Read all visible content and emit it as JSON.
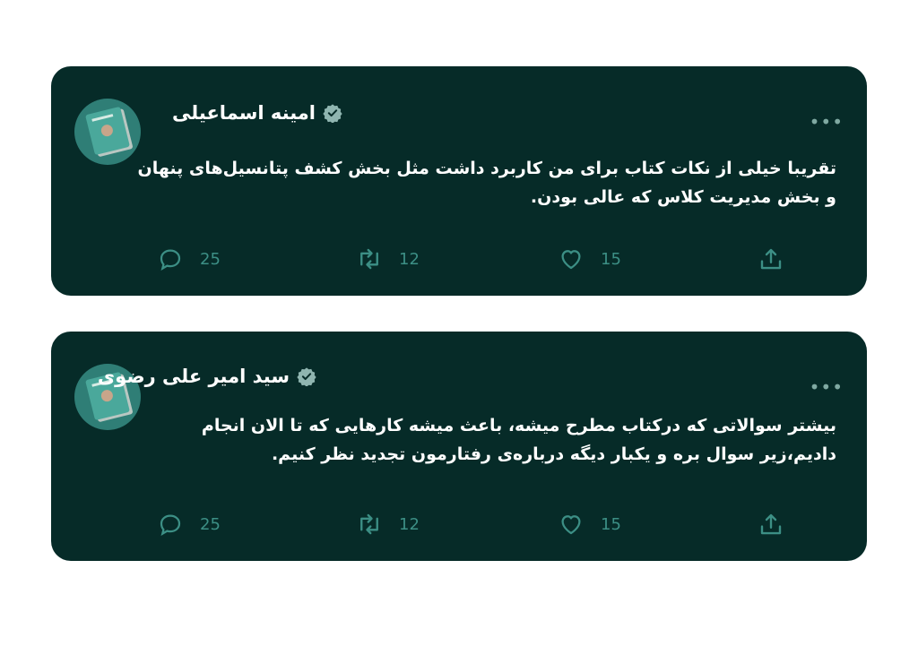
{
  "posts": [
    {
      "author": "امینه اسماعیلی",
      "text": "تقریبا خیلی از نکات کتاب برای من کاربرد داشت مثل بخش کشف پتانسیل‌های پنهان و بخش مدیریت کلاس که عالی بودن.",
      "replies": "25",
      "retweets": "12",
      "likes": "15"
    },
    {
      "author": "سید امیر علی رضوی",
      "text": "بیشتر سوالاتی که درکتاب مطرح میشه، باعث میشه کارهایی که تا الان انجام دادیم،زیر سوال بره و یکبار دیگه درباره‌ی رفتارمون تجدید نظر کنیم.",
      "replies": "25",
      "retweets": "12",
      "likes": "15"
    }
  ],
  "icons": {
    "more": "more-icon",
    "verified": "verified-badge-icon",
    "reply": "reply-icon",
    "retweet": "retweet-icon",
    "like": "heart-icon",
    "share": "share-icon"
  },
  "colors": {
    "card_bg": "#062b28",
    "accent": "#3c8f85",
    "text": "#ffffff",
    "page_bg": "#ffffff"
  }
}
